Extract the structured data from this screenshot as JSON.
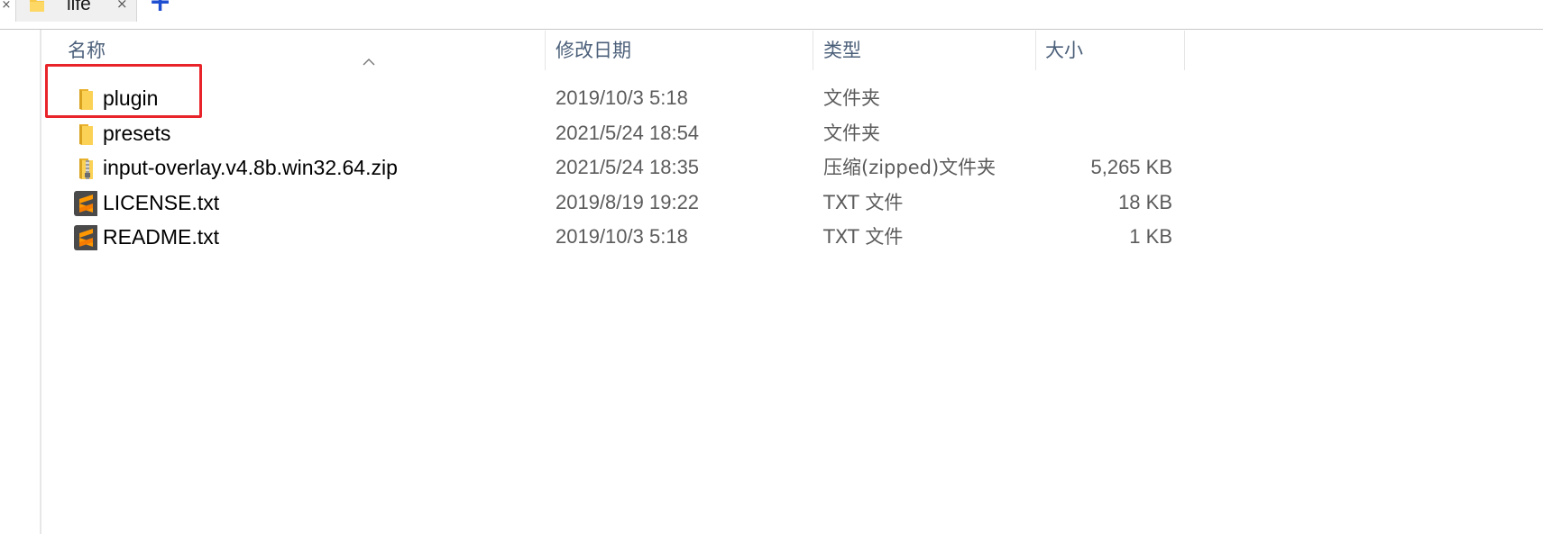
{
  "tabs": [
    {
      "title": "life",
      "icon": "folder-icon",
      "close_glyph": "×"
    }
  ],
  "tabstrip": {
    "left_close_glyph": "×",
    "new_tab_glyph": "+"
  },
  "columns": {
    "name": "名称",
    "modified": "修改日期",
    "type": "类型",
    "size": "大小",
    "sorted_by": "name"
  },
  "files": [
    {
      "name": "plugin",
      "modified": "2019/10/3 5:18",
      "type": "文件夹",
      "size": "",
      "icon": "folder-icon"
    },
    {
      "name": "presets",
      "modified": "2021/5/24 18:54",
      "type": "文件夹",
      "size": "",
      "icon": "folder-icon"
    },
    {
      "name": "input-overlay.v4.8b.win32.64.zip",
      "modified": "2021/5/24 18:35",
      "type": "压缩(zipped)文件夹",
      "size": "5,265 KB",
      "icon": "zip-folder-icon"
    },
    {
      "name": "LICENSE.txt",
      "modified": "2019/8/19 19:22",
      "type": "TXT 文件",
      "size": "18 KB",
      "icon": "sublime-text-icon"
    },
    {
      "name": "README.txt",
      "modified": "2019/10/3 5:18",
      "type": "TXT 文件",
      "size": "1 KB",
      "icon": "sublime-text-icon"
    }
  ],
  "colors": {
    "header_text": "#4c607a",
    "secondary_text": "#5b5b5b",
    "highlight_border": "#e8242a",
    "folder": "#f8c846",
    "new_tab": "#1f4fd1"
  }
}
